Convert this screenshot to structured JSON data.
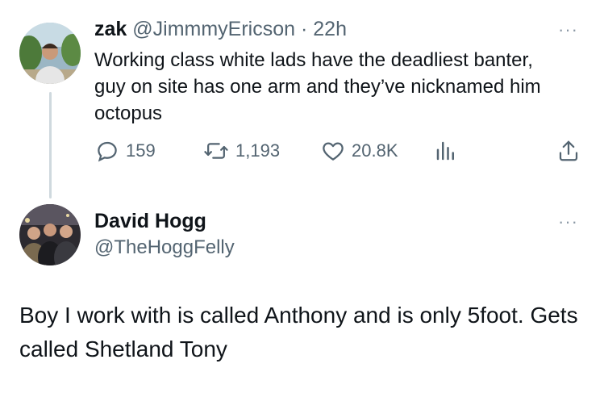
{
  "reply_to": {
    "name": "zak",
    "handle": "@JimmmyEricson",
    "time": "· 22h",
    "text": "Working class white lads have the deadliest banter, guy on site has one arm and they’ve nicknamed him octopus",
    "stats": {
      "replies": "159",
      "reposts": "1,193",
      "likes": "20.8K"
    },
    "icons": [
      "reply-icon",
      "repost-icon",
      "like-icon",
      "views-icon",
      "share-icon",
      "more-icon"
    ]
  },
  "main_post": {
    "name": "David Hogg",
    "handle": "@TheHoggFelly",
    "text": "Boy I work with is called Anthony and is only 5foot. Gets called Shetland Tony"
  },
  "colors": {
    "text": "#0f1419",
    "muted": "#536471",
    "thread_line": "#cfd9de",
    "background": "#ffffff"
  },
  "more_label": "···"
}
